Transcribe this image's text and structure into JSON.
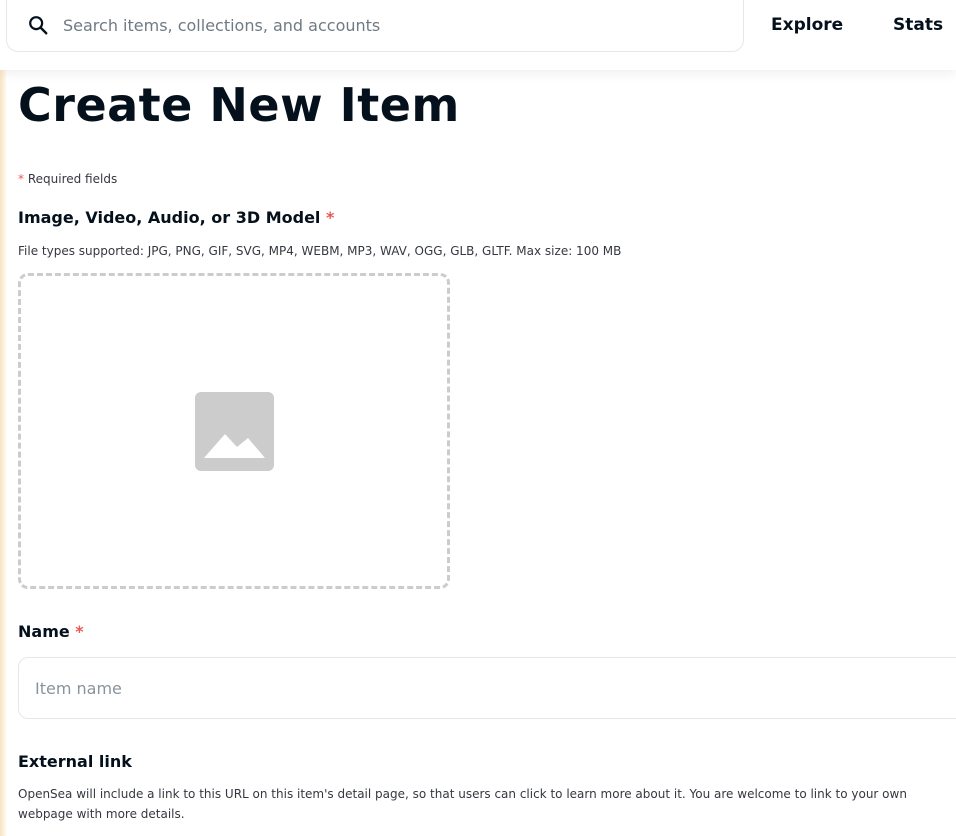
{
  "header": {
    "search": {
      "icon": "search-icon",
      "placeholder": "Search items, collections, and accounts"
    },
    "nav": {
      "explore": "Explore",
      "stats": "Stats"
    }
  },
  "main": {
    "title": "Create New Item",
    "required_note": {
      "asterisk": "*",
      "text": "Required fields"
    },
    "media": {
      "label": "Image, Video, Audio, or 3D Model",
      "required_mark": "*",
      "description": "File types supported: JPG, PNG, GIF, SVG, MP4, WEBM, MP3, WAV, OGG, GLB, GLTF. Max size: 100 MB",
      "icon": "image-placeholder-icon"
    },
    "name": {
      "label": "Name",
      "required_mark": "*",
      "value": "",
      "placeholder": "Item name"
    },
    "external_link": {
      "label": "External link",
      "description": "OpenSea will include a link to this URL on this item's detail page, so that users can click to learn more about it. You are welcome to link to your own webpage with more details."
    }
  },
  "colors": {
    "text_primary": "#04111d",
    "text_secondary": "#353840",
    "required_red": "#eb5757",
    "border": "#e5e8eb",
    "dashed_border": "#cccccc",
    "icon_gray": "#cccccc"
  }
}
